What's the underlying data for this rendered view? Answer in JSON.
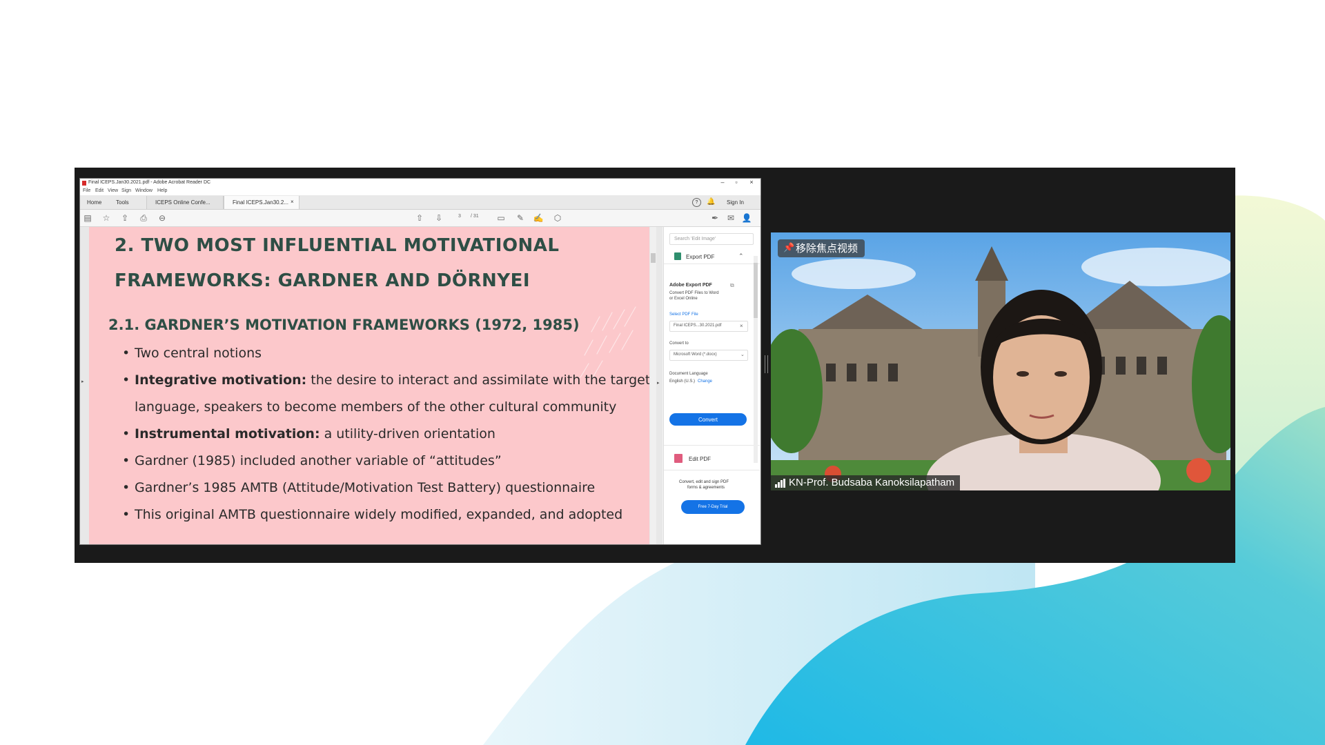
{
  "acrobat": {
    "window_title": "Final ICEPS.Jan30.2021.pdf - Adobe Acrobat Reader DC",
    "menu": [
      "File",
      "Edit",
      "View",
      "Sign",
      "Window",
      "Help"
    ],
    "nav_tabs": [
      "Home",
      "Tools"
    ],
    "doc_tabs": [
      "ICEPS Online Confe...",
      "Final ICEPS.Jan30.2..."
    ],
    "sign_in": "Sign In",
    "page_current": "3",
    "page_total": "/ 31"
  },
  "slide": {
    "heading_line1": "2. TWO MOST INFLUENTIAL MOTIVATIONAL",
    "heading_line2": "FRAMEWORKS: GARDNER AND DÖRNYEI",
    "subheading": "2.1. GARDNER’S MOTIVATION FRAMEWORKS (1972, 1985)",
    "bullets": [
      {
        "bold": "",
        "text": "Two central notions"
      },
      {
        "bold": "Integrative motivation:",
        "text": " the desire to interact and assimilate with the target"
      },
      {
        "bold": "",
        "text": "language, speakers to become members of the other cultural community"
      },
      {
        "bold": "Instrumental motivation:",
        "text": " a utility-driven orientation"
      },
      {
        "bold": "",
        "text": "Gardner (1985) included another variable of “attitudes”"
      },
      {
        "bold": "",
        "text": "Gardner’s 1985 AMTB (Attitude/Motivation Test Battery) questionnaire"
      },
      {
        "bold": "",
        "text": "This original AMTB questionnaire widely modified, expanded, and adopted"
      }
    ]
  },
  "right_panel": {
    "search_placeholder": "Search 'Edit Image'",
    "export_label": "Export PDF",
    "adobe_export_title": "Adobe Export PDF",
    "adobe_export_desc1": "Convert PDF Files to Word",
    "adobe_export_desc2": "or Excel Online",
    "select_pdf_label": "Select PDF File",
    "selected_file": "Final ICEPS...30.2021.pdf",
    "convert_to_label": "Convert to",
    "convert_to_value": "Microsoft Word (*.docx)",
    "doc_language_label": "Document Language",
    "doc_language_value": "English (U.S.)",
    "change_link": "Change",
    "convert_button": "Convert",
    "edit_pdf_label": "Edit PDF",
    "promo_line1": "Convert, edit and sign PDF",
    "promo_line2": "forms & agreements",
    "trial_button": "Free 7-Day Trial"
  },
  "video": {
    "pin_label": "移除焦点视频",
    "participant_name": "KN-Prof. Budsaba Kanoksilapatham"
  },
  "colors": {
    "slide_bg": "#fcc8cb",
    "heading": "#2e4e45",
    "acrobat_blue": "#1473e6",
    "wave_teal": "#48c6e0"
  }
}
